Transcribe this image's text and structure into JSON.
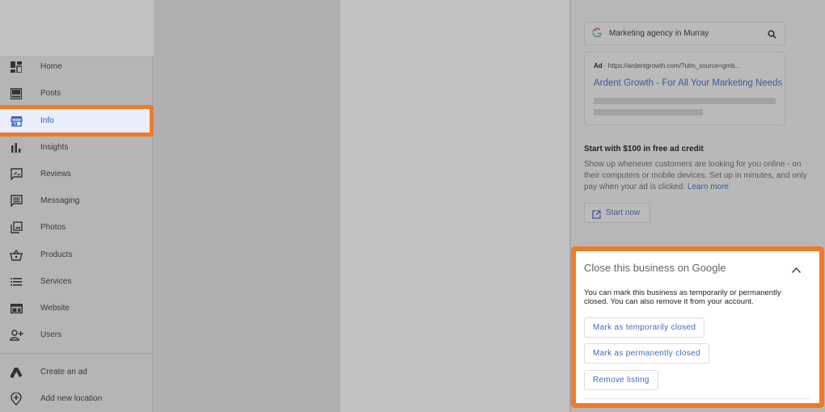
{
  "sidebar": {
    "items": [
      {
        "label": "Home",
        "icon": "dashboard-icon"
      },
      {
        "label": "Posts",
        "icon": "posts-icon"
      },
      {
        "label": "Info",
        "icon": "storefront-icon",
        "active": true
      },
      {
        "label": "Insights",
        "icon": "bar-chart-icon"
      },
      {
        "label": "Reviews",
        "icon": "rate-review-icon"
      },
      {
        "label": "Messaging",
        "icon": "message-icon"
      },
      {
        "label": "Photos",
        "icon": "photo-library-icon"
      },
      {
        "label": "Products",
        "icon": "shopping-basket-icon"
      },
      {
        "label": "Services",
        "icon": "list-icon"
      },
      {
        "label": "Website",
        "icon": "web-icon"
      },
      {
        "label": "Users",
        "icon": "person-add-icon"
      }
    ],
    "footer_items": [
      {
        "label": "Create an ad",
        "icon": "google-ads-icon"
      },
      {
        "label": "Add new location",
        "icon": "add-location-icon"
      }
    ]
  },
  "ad_preview": {
    "search_query": "Marketing agency in Murray",
    "ad_badge": "Ad",
    "ad_url": "https://ardentgrowth.com/?utm_source=gmb...",
    "ad_title": "Ardent Growth - For All Your Marketing Needs"
  },
  "promo": {
    "title": "Start with $100 in free ad credit",
    "body": "Show up whenever customers are looking for you online - on their computers or mobile devices. Set up in minutes, and only pay when your ad is clicked.",
    "learn_more": "Learn more",
    "start_button": "Start now"
  },
  "close_business": {
    "title": "Close this business on Google",
    "description": "You can mark this business as temporarily or permanently closed. You can also remove it from your account.",
    "buttons": [
      "Mark as temporarily closed",
      "Mark as permanently closed",
      "Remove listing"
    ]
  },
  "colors": {
    "highlight": "#ee7b2a",
    "link": "#3c6bc4",
    "active_bg": "#e8eefb"
  }
}
